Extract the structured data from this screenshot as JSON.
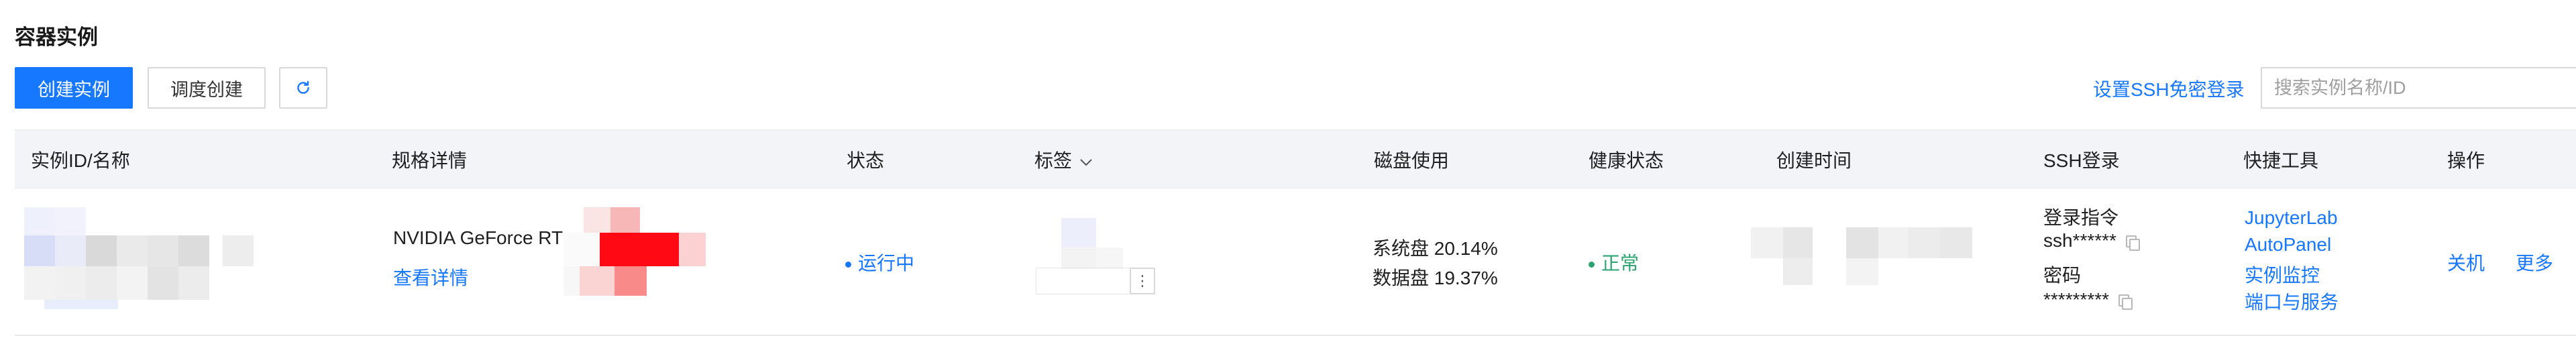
{
  "page": {
    "title": "容器实例"
  },
  "toolbar": {
    "create_label": "创建实例",
    "schedule_label": "调度创建",
    "refresh_icon": "refresh-icon",
    "ssh_link": "设置SSH免密登录",
    "search_placeholder": "搜索实例名称/ID"
  },
  "table": {
    "columns": {
      "id_name": "实例ID/名称",
      "spec": "规格详情",
      "status": "状态",
      "tags": "标签",
      "disk": "磁盘使用",
      "health": "健康状态",
      "created": "创建时间",
      "ssh": "SSH登录",
      "tools": "快捷工具",
      "actions": "操作"
    },
    "rows": [
      {
        "spec_name": "NVIDIA GeForce RT",
        "spec_detail_link": "查看详情",
        "status": "运行中",
        "disk_system": "系统盘 20.14%",
        "disk_data": "数据盘 19.37%",
        "health": "正常",
        "ssh_cmd_label": "登录指令",
        "ssh_cmd_value": "ssh******",
        "ssh_pwd_label": "密码",
        "ssh_pwd_value": "*********",
        "tools": [
          "JupyterLab",
          "AutoPanel",
          "实例监控",
          "端口与服务"
        ],
        "action_shutdown": "关机",
        "action_more": "更多"
      }
    ]
  },
  "colors": {
    "primary": "#1677ff",
    "success": "#2ba471",
    "header_bg": "#f3f4f7"
  }
}
